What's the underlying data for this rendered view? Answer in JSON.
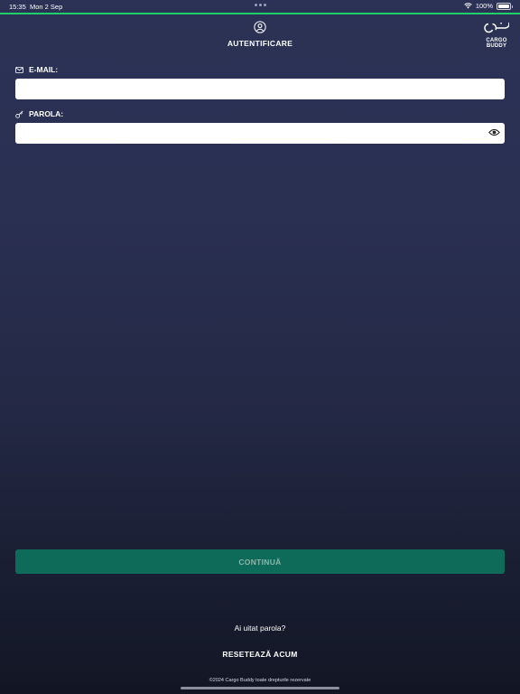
{
  "status_bar": {
    "time": "15:35",
    "date": "Mon 2 Sep",
    "battery": "100%",
    "wifi_icon": "wifi-icon",
    "battery_level": 1.0
  },
  "header": {
    "title": "AUTENTIFICARE",
    "icon": "user-circle-icon",
    "logo_text_line1": "CARGO",
    "logo_text_line2": "BUDDY"
  },
  "form": {
    "email_label": "E-MAIL:",
    "email_icon": "mail-icon",
    "email_value": "",
    "password_label": "PAROLA:",
    "password_icon": "key-icon",
    "password_value": "",
    "show_password_icon": "eye-icon"
  },
  "actions": {
    "continue_label": "CONTINUĂ",
    "forgot_text": "Ai uitat parola?",
    "reset_label": "RESETEAZĂ ACUM"
  },
  "footer": {
    "copyright": "©2024 Cargo Buddy toate drepturile rezervate"
  },
  "colors": {
    "accent": "#1fcf6a",
    "button": "#0e6b5a",
    "background_top": "#2b3255",
    "background_bottom": "#121624"
  }
}
